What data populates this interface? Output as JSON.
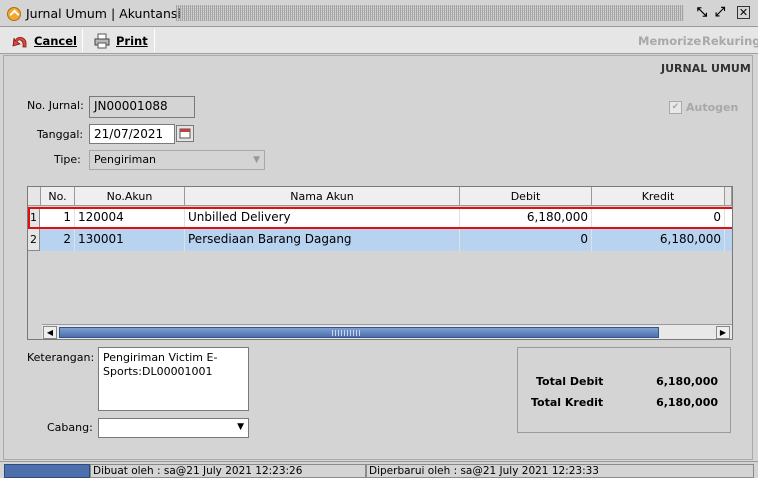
{
  "window": {
    "title": "Jurnal Umum | Akuntansi"
  },
  "toolbar": {
    "cancel_label": "Cancel",
    "print_label": "Print",
    "memorize_label": "Memorize",
    "rekuring_label": "Rekuring"
  },
  "header": {
    "section_title": "JURNAL UMUM"
  },
  "form": {
    "no_jurnal_label": "No. Jurnal:",
    "no_jurnal_value": "JN00001088",
    "tanggal_label": "Tanggal:",
    "tanggal_value": "21/07/2021",
    "tipe_label": "Tipe:",
    "tipe_value": "Pengiriman",
    "autogen_label": "Autogen",
    "autogen_checked": true,
    "keterangan_label": "Keterangan:",
    "keterangan_value": "Pengiriman Victim E-Sports:DL00001001",
    "cabang_label": "Cabang:",
    "cabang_value": ""
  },
  "grid": {
    "columns": [
      "No.",
      "No.Akun",
      "Nama Akun",
      "Debit",
      "Kredit"
    ],
    "rows": [
      {
        "row_index": "1",
        "no": "1",
        "akun": "120004",
        "nama": "Unbilled Delivery",
        "debit": "6,180,000",
        "kredit": "0"
      },
      {
        "row_index": "2",
        "no": "2",
        "akun": "130001",
        "nama": "Persediaan Barang Dagang",
        "debit": "0",
        "kredit": "6,180,000"
      }
    ]
  },
  "totals": {
    "debit_label": "Total Debit",
    "debit_value": "6,180,000",
    "kredit_label": "Total Kredit",
    "kredit_value": "6,180,000"
  },
  "status": {
    "created": "Dibuat oleh : sa@21 July 2021  12:23:26",
    "updated": "Diperbarui oleh : sa@21 July 2021  12:23:33"
  },
  "colors": {
    "selection_row": "#b8d3f0",
    "highlight_border": "#e01010",
    "accent_blue": "#4d70ad"
  }
}
